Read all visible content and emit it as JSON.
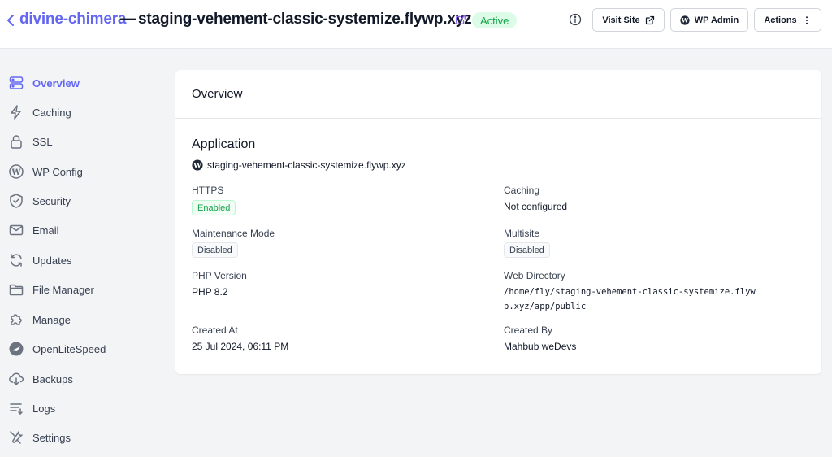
{
  "header": {
    "site_name": "divine-chimera",
    "separator": "—",
    "domain": "staging-vehement-classic-systemize.flywp.xyz",
    "status": "Active",
    "visit_site_label": "Visit Site",
    "wp_admin_label": "WP Admin",
    "actions_label": "Actions"
  },
  "sidebar": {
    "items": [
      {
        "label": "Overview",
        "icon": "server-icon",
        "active": true
      },
      {
        "label": "Caching",
        "icon": "lightning-icon"
      },
      {
        "label": "SSL",
        "icon": "lock-icon"
      },
      {
        "label": "WP Config",
        "icon": "wordpress-icon"
      },
      {
        "label": "Security",
        "icon": "shield-icon"
      },
      {
        "label": "Email",
        "icon": "mail-icon"
      },
      {
        "label": "Updates",
        "icon": "refresh-icon"
      },
      {
        "label": "File Manager",
        "icon": "folder-icon"
      },
      {
        "label": "Manage",
        "icon": "puzzle-icon"
      },
      {
        "label": "OpenLiteSpeed",
        "icon": "openlitespeed-icon"
      },
      {
        "label": "Backups",
        "icon": "cloud-download-icon"
      },
      {
        "label": "Logs",
        "icon": "list-icon"
      },
      {
        "label": "Settings",
        "icon": "tools-icon"
      }
    ]
  },
  "main": {
    "card_title": "Overview",
    "section_title": "Application",
    "app_domain": "staging-vehement-classic-systemize.flywp.xyz",
    "fields": {
      "https_label": "HTTPS",
      "https_value": "Enabled",
      "caching_label": "Caching",
      "caching_value": "Not configured",
      "maintenance_label": "Maintenance Mode",
      "maintenance_value": "Disabled",
      "multisite_label": "Multisite",
      "multisite_value": "Disabled",
      "php_label": "PHP Version",
      "php_value": "PHP 8.2",
      "webdir_label": "Web Directory",
      "webdir_value_line1": "/home/fly/staging-vehement-classic-systemize.flyw",
      "webdir_value_line2": "p.xyz/app/public",
      "created_at_label": "Created At",
      "created_at_value": "25 Jul 2024, 06:11 PM",
      "created_by_label": "Created By",
      "created_by_value": "Mahbub weDevs"
    }
  },
  "colors": {
    "accent": "#6366f1",
    "active_green": "#16a34a",
    "active_bg": "#dcfce7"
  }
}
